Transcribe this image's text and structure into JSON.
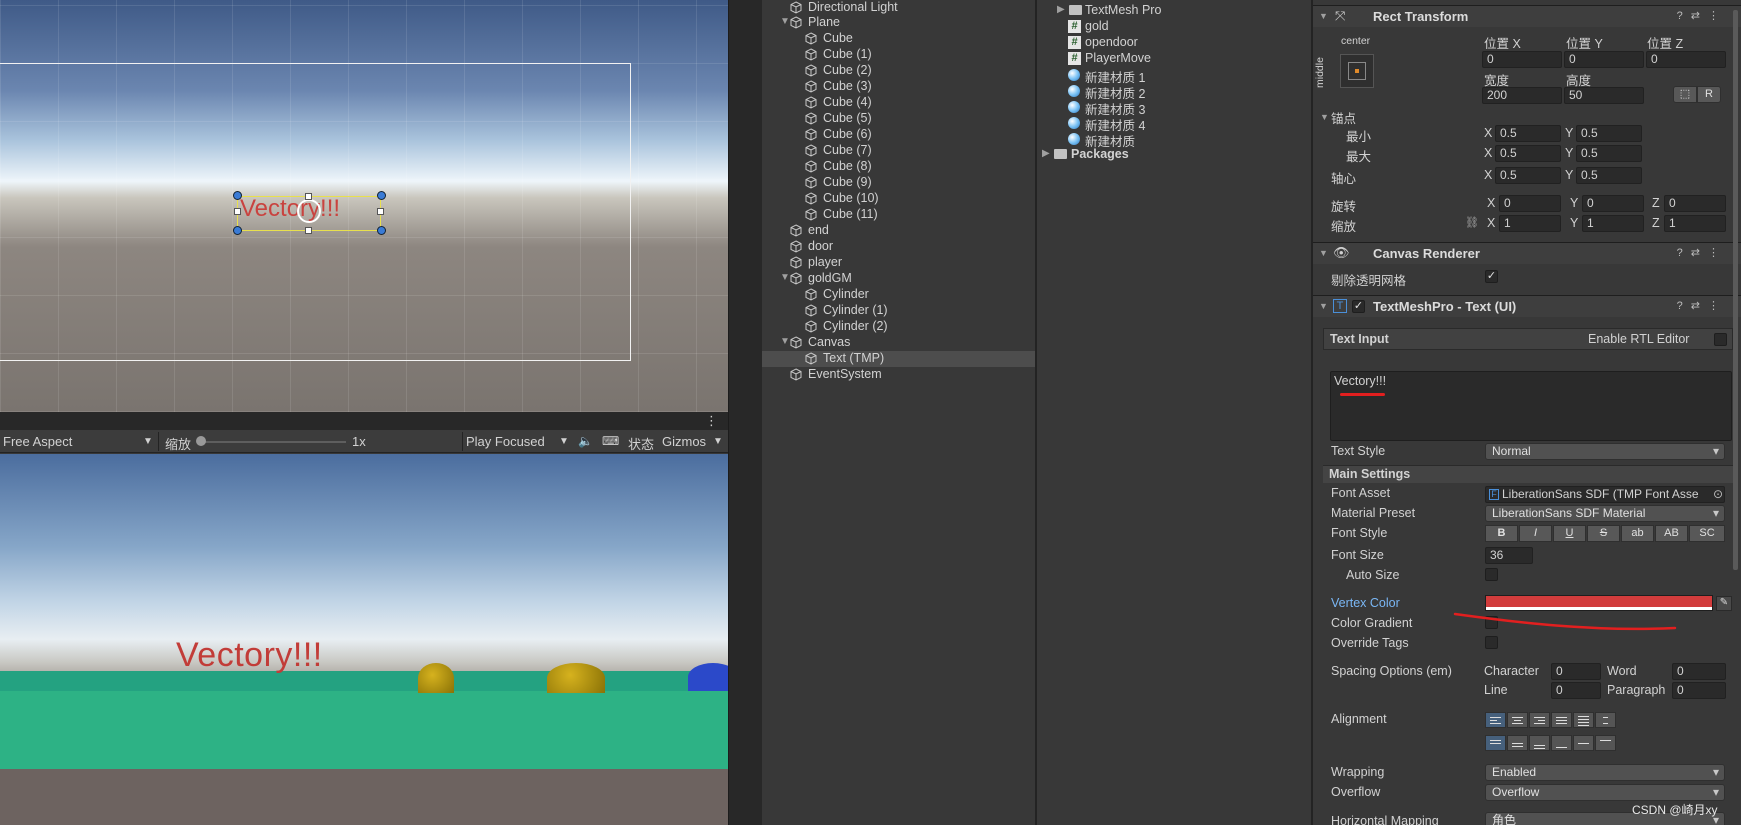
{
  "scene": {
    "text": "Vectory!!!"
  },
  "game_toolbar": {
    "aspect": "Free Aspect",
    "scale_label": "缩放",
    "scale_value": "1x",
    "play_mode": "Play Focused",
    "stats": "状态",
    "gizmos": "Gizmos",
    "more": "⋮"
  },
  "game": {
    "text": "Vectory!!!"
  },
  "hierarchy": {
    "items": [
      {
        "label": "Directional Light"
      },
      {
        "label": "Plane"
      },
      {
        "label": "Cube"
      },
      {
        "label": "Cube (1)"
      },
      {
        "label": "Cube (2)"
      },
      {
        "label": "Cube (3)"
      },
      {
        "label": "Cube (4)"
      },
      {
        "label": "Cube (5)"
      },
      {
        "label": "Cube (6)"
      },
      {
        "label": "Cube (7)"
      },
      {
        "label": "Cube (8)"
      },
      {
        "label": "Cube (9)"
      },
      {
        "label": "Cube (10)"
      },
      {
        "label": "Cube (11)"
      },
      {
        "label": "end"
      },
      {
        "label": "door"
      },
      {
        "label": "player"
      },
      {
        "label": "goldGM"
      },
      {
        "label": "Cylinder"
      },
      {
        "label": "Cylinder (1)"
      },
      {
        "label": "Cylinder (2)"
      },
      {
        "label": "Canvas"
      },
      {
        "label": "Text (TMP)"
      },
      {
        "label": "EventSystem"
      }
    ]
  },
  "project": {
    "items": [
      {
        "label": "TextMesh Pro",
        "icon": "folder-icon"
      },
      {
        "label": "gold",
        "icon": "script-icon"
      },
      {
        "label": "opendoor",
        "icon": "script-icon"
      },
      {
        "label": "PlayerMove",
        "icon": "script-icon"
      },
      {
        "label": "新建材质 1",
        "icon": "material-icon"
      },
      {
        "label": "新建材质 2",
        "icon": "material-icon"
      },
      {
        "label": "新建材质 3",
        "icon": "material-icon"
      },
      {
        "label": "新建材质 4",
        "icon": "material-icon"
      },
      {
        "label": "新建材质",
        "icon": "material-icon"
      },
      {
        "label": "Packages",
        "icon": "folder-icon"
      }
    ]
  },
  "inspector": {
    "rect_transform": {
      "title": "Rect Transform",
      "anchor_h": "center",
      "anchor_v": "middle",
      "pos_x_label": "位置 X",
      "pos_y_label": "位置 Y",
      "pos_z_label": "位置 Z",
      "pos_x": "0",
      "pos_y": "0",
      "pos_z": "0",
      "width_label": "宽度",
      "height_label": "高度",
      "width": "200",
      "height": "50",
      "r_button": "R",
      "anchors_label": "锚点",
      "min_label": "最小",
      "max_label": "最大",
      "min_x": "0.5",
      "min_y": "0.5",
      "max_x": "0.5",
      "max_y": "0.5",
      "pivot_label": "轴心",
      "pivot_x": "0.5",
      "pivot_y": "0.5",
      "rotation_label": "旋转",
      "rot_x": "0",
      "rot_y": "0",
      "rot_z": "0",
      "scale_label": "缩放",
      "scale_x": "1",
      "scale_y": "1",
      "scale_z": "1",
      "x": "X",
      "y": "Y",
      "z": "Z"
    },
    "canvas_renderer": {
      "title": "Canvas Renderer",
      "cull_label": "剔除透明网格",
      "cull_checked": true
    },
    "tmp": {
      "title": "TextMeshPro - Text (UI)",
      "text_input_label": "Text Input",
      "rtl_label": "Enable RTL Editor",
      "text": "Vectory!!!",
      "text_style_label": "Text Style",
      "text_style": "Normal",
      "main_settings": "Main Settings",
      "font_asset_label": "Font Asset",
      "font_asset": "LiberationSans SDF (TMP Font Asse",
      "material_preset_label": "Material Preset",
      "material_preset": "LiberationSans SDF Material",
      "font_style_label": "Font Style",
      "font_style_buttons": [
        "B",
        "I",
        "U",
        "S",
        "ab",
        "AB",
        "SC"
      ],
      "font_size_label": "Font Size",
      "font_size": "36",
      "auto_size_label": "Auto Size",
      "vertex_color_label": "Vertex Color",
      "vertex_color": "#d23c3c",
      "color_gradient_label": "Color Gradient",
      "override_tags_label": "Override Tags",
      "spacing_label": "Spacing Options (em)",
      "character_label": "Character",
      "character": "0",
      "word_label": "Word",
      "word": "0",
      "line_label": "Line",
      "line": "0",
      "paragraph_label": "Paragraph",
      "paragraph": "0",
      "alignment_label": "Alignment",
      "wrapping_label": "Wrapping",
      "wrapping": "Enabled",
      "overflow_label": "Overflow",
      "overflow": "Overflow",
      "hmap_label": "Horizontal Mapping",
      "hmap": "角色"
    }
  },
  "watermark": "CSDN @崎月xy"
}
